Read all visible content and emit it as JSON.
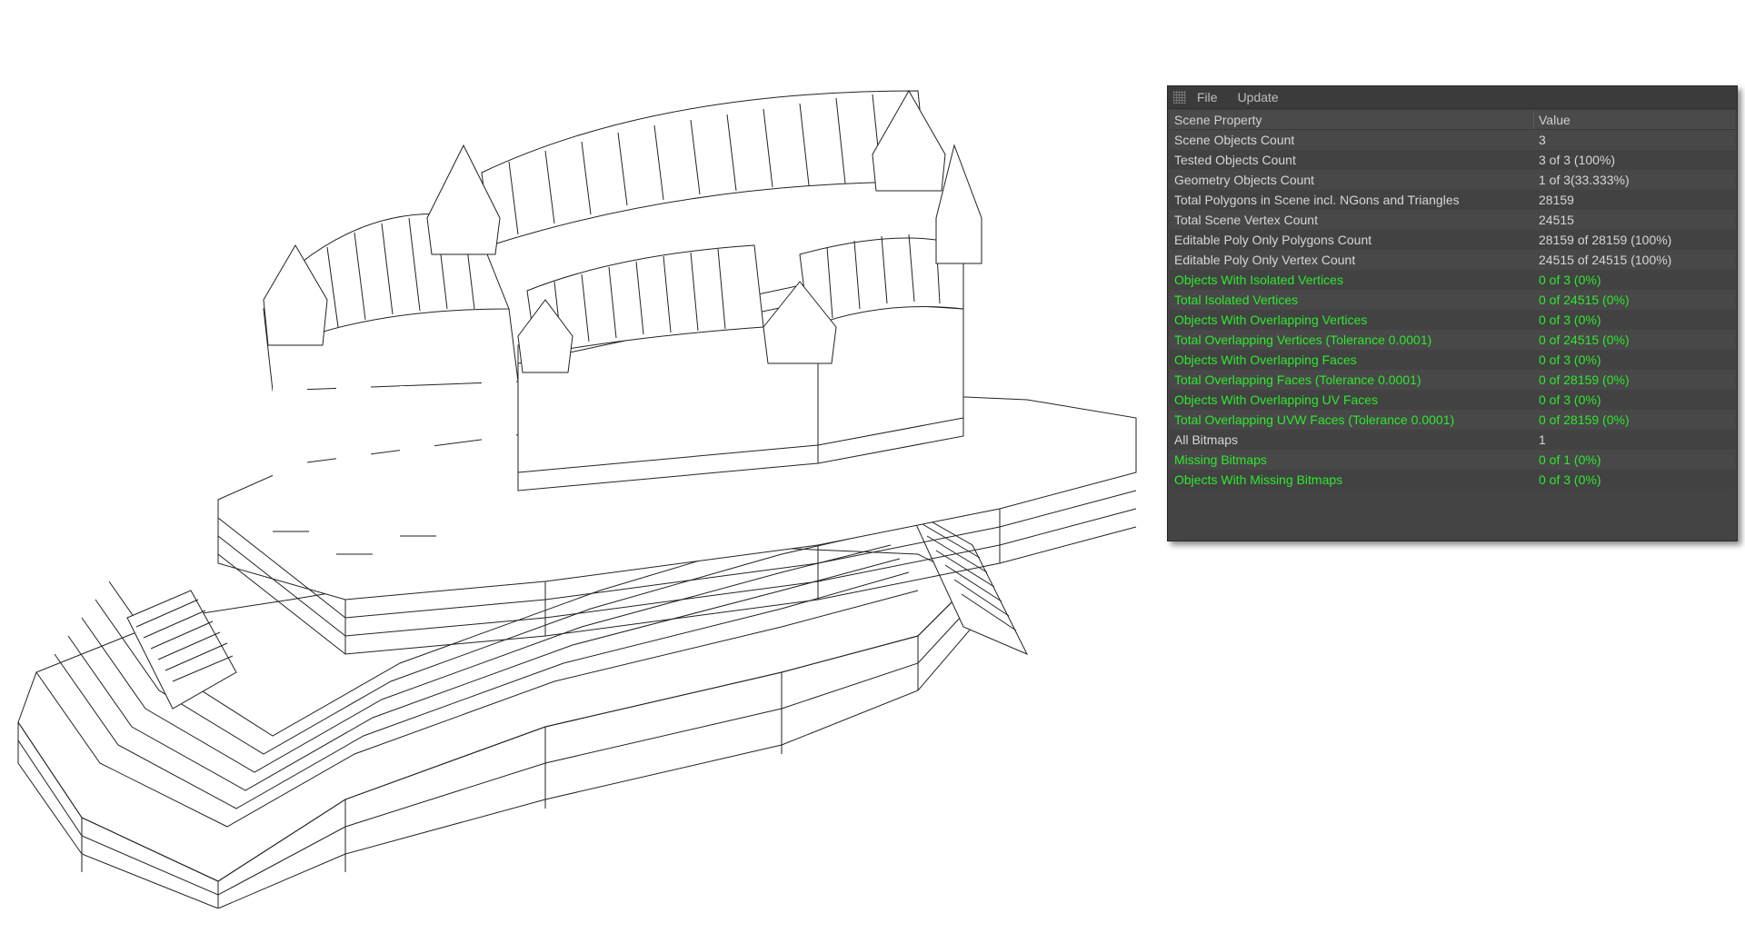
{
  "menu": {
    "file": "File",
    "update": "Update"
  },
  "table": {
    "headers": {
      "property": "Scene Property",
      "value": "Value"
    },
    "rows": [
      {
        "property": "Scene Objects Count",
        "value": "3",
        "status": "info"
      },
      {
        "property": "Tested Objects Count",
        "value": "3 of 3 (100%)",
        "status": "info"
      },
      {
        "property": "Geometry Objects Count",
        "value": "1 of 3(33.333%)",
        "status": "info"
      },
      {
        "property": "Total Polygons in Scene incl. NGons and Triangles",
        "value": "28159",
        "status": "info"
      },
      {
        "property": "Total Scene Vertex Count",
        "value": "24515",
        "status": "info"
      },
      {
        "property": "Editable Poly Only Polygons Count",
        "value": "28159 of 28159 (100%)",
        "status": "info"
      },
      {
        "property": "Editable Poly Only Vertex Count",
        "value": "24515 of 24515 (100%)",
        "status": "info"
      },
      {
        "property": "Objects With Isolated Vertices",
        "value": "0 of 3 (0%)",
        "status": "ok"
      },
      {
        "property": "Total Isolated Vertices",
        "value": "0 of 24515 (0%)",
        "status": "ok"
      },
      {
        "property": "Objects With Overlapping Vertices",
        "value": "0 of 3 (0%)",
        "status": "ok"
      },
      {
        "property": "Total Overlapping Vertices (Tolerance 0.0001)",
        "value": "0 of 24515 (0%)",
        "status": "ok"
      },
      {
        "property": "Objects With Overlapping Faces",
        "value": "0 of 3 (0%)",
        "status": "ok"
      },
      {
        "property": "Total Overlapping Faces (Tolerance 0.0001)",
        "value": "0 of 28159 (0%)",
        "status": "ok"
      },
      {
        "property": "Objects With Overlapping UV Faces",
        "value": "0 of 3 (0%)",
        "status": "ok"
      },
      {
        "property": "Total Overlapping UVW Faces (Tolerance 0.0001)",
        "value": "0 of 28159 (0%)",
        "status": "ok"
      },
      {
        "property": "All Bitmaps",
        "value": "1",
        "status": "info"
      },
      {
        "property": "Missing Bitmaps",
        "value": "0 of 1 (0%)",
        "status": "ok"
      },
      {
        "property": "Objects With Missing Bitmaps",
        "value": "0 of 3 (0%)",
        "status": "ok"
      }
    ]
  },
  "colors": {
    "ok": "#2ee82e",
    "info": "#d6d6d6",
    "panel_bg": "#444444"
  }
}
